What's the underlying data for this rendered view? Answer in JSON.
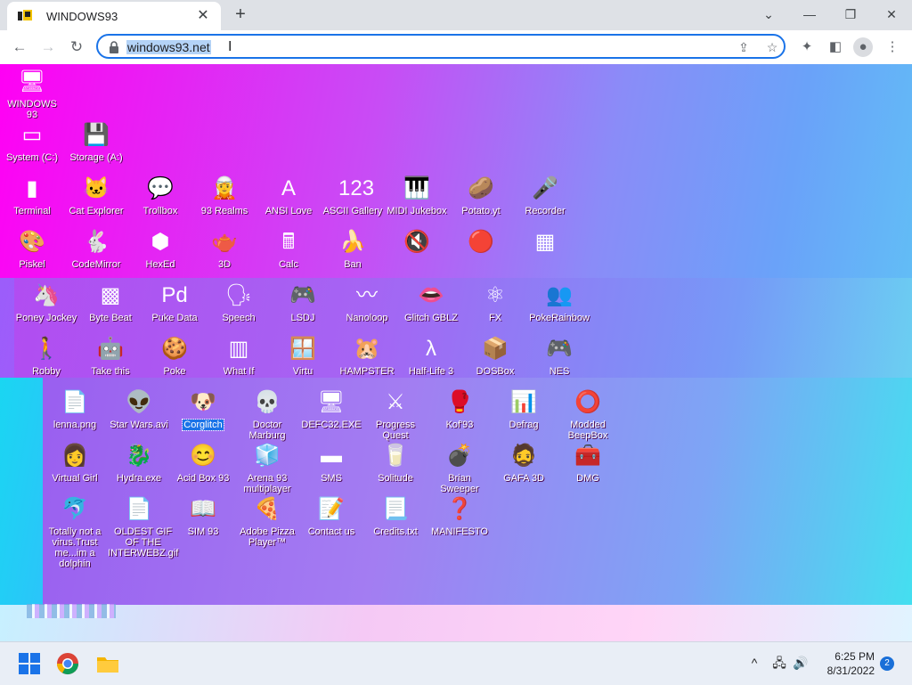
{
  "browser": {
    "tab_title": "WINDOWS93",
    "url": "windows93.net",
    "new_tab_label": "+",
    "close_tab_label": "✕"
  },
  "desktop": {
    "icons": [
      {
        "label": "WINDOWS 93",
        "glyph": "🖥"
      },
      {
        "label": "System (C:)",
        "glyph": "▭"
      },
      {
        "label": "Storage (A:)",
        "glyph": "💾"
      },
      {
        "label": "Terminal",
        "glyph": "▮"
      },
      {
        "label": "Cat Explorer",
        "glyph": "🐱"
      },
      {
        "label": "Trollbox",
        "glyph": "💬"
      },
      {
        "label": "93 Realms",
        "glyph": "🧝"
      },
      {
        "label": "ANSI Love",
        "glyph": "A"
      },
      {
        "label": "ASCII Gallery",
        "glyph": "123"
      },
      {
        "label": "MIDI Jukebox",
        "glyph": "🎹"
      },
      {
        "label": "Potato.yt",
        "glyph": "🥔"
      },
      {
        "label": "Recorder",
        "glyph": "🎤"
      },
      {
        "label": "Piskel",
        "glyph": "🎨"
      },
      {
        "label": "CodeMirror",
        "glyph": "🐇"
      },
      {
        "label": "HexEd",
        "glyph": "⬢"
      },
      {
        "label": "3D",
        "glyph": "🫖"
      },
      {
        "label": "Calc",
        "glyph": "🖩"
      },
      {
        "label": "Ban",
        "glyph": "🍌"
      },
      {
        "label": "",
        "glyph": "🔇"
      },
      {
        "label": "",
        "glyph": "🔴"
      },
      {
        "label": "",
        "glyph": "▦"
      },
      {
        "label": "Poney Jockey",
        "glyph": "🦄"
      },
      {
        "label": "Byte Beat",
        "glyph": "▩"
      },
      {
        "label": "Puke Data",
        "glyph": "Pd"
      },
      {
        "label": "Speech",
        "glyph": "🗣"
      },
      {
        "label": "LSDJ",
        "glyph": "🎮"
      },
      {
        "label": "Nanoloop",
        "glyph": "〰"
      },
      {
        "label": "Glitch GBLZ",
        "glyph": "👄"
      },
      {
        "label": "FX",
        "glyph": "⚛"
      },
      {
        "label": "PokeRainbow",
        "glyph": "👥"
      },
      {
        "label": "Robby",
        "glyph": "🚶"
      },
      {
        "label": "Take this",
        "glyph": "🤖"
      },
      {
        "label": "Poke",
        "glyph": "🍪"
      },
      {
        "label": "What If",
        "glyph": "▥"
      },
      {
        "label": "Virtu",
        "glyph": "🪟"
      },
      {
        "label": "HAMPSTER",
        "glyph": "🐹"
      },
      {
        "label": "Half-Life 3",
        "glyph": "λ"
      },
      {
        "label": "DOSBox",
        "glyph": "📦"
      },
      {
        "label": "NES",
        "glyph": "🎮"
      },
      {
        "label": "lenna.png",
        "glyph": "📄"
      },
      {
        "label": "Star Wars.avi",
        "glyph": "👽"
      },
      {
        "label": "Corglitch",
        "glyph": "🐶"
      },
      {
        "label": "Doctor Marburg",
        "glyph": "💀"
      },
      {
        "label": "DEFC32.EXE",
        "glyph": "🖥"
      },
      {
        "label": "Progress Quest",
        "glyph": "⚔"
      },
      {
        "label": "Kof'93",
        "glyph": "🥊"
      },
      {
        "label": "Defrag",
        "glyph": "📊"
      },
      {
        "label": "Modded BeepBox",
        "glyph": "⭕"
      },
      {
        "label": "Virtual Girl",
        "glyph": "👩"
      },
      {
        "label": "Hydra.exe",
        "glyph": "🐉"
      },
      {
        "label": "Acid Box 93",
        "glyph": "😊"
      },
      {
        "label": "Arena 93 multiplayer",
        "glyph": "🧊"
      },
      {
        "label": "SMS",
        "glyph": "▬"
      },
      {
        "label": "Solitude",
        "glyph": "🥛"
      },
      {
        "label": "Brian Sweeper",
        "glyph": "💣"
      },
      {
        "label": "GAFA 3D",
        "glyph": "🧔"
      },
      {
        "label": "DMG",
        "glyph": "🧰"
      },
      {
        "label": "Totally not a virus.Trust me...im a dolphin",
        "glyph": "🐬"
      },
      {
        "label": "OLDEST GIF OF THE INTERWEBZ.gif",
        "glyph": "📄"
      },
      {
        "label": "SIM 93",
        "glyph": "📖"
      },
      {
        "label": "Adobe Pizza Player™",
        "glyph": "🍕"
      },
      {
        "label": "Contact us",
        "glyph": "📝"
      },
      {
        "label": "Credits.txt",
        "glyph": "📃"
      },
      {
        "label": "MANIFESTO",
        "glyph": "❓"
      }
    ]
  },
  "taskbar": {
    "time": "6:25 PM",
    "date": "8/31/2022",
    "notifications": "2"
  },
  "colors": {
    "accent": "#1a73e8",
    "taskbar": "#e9eef6"
  }
}
